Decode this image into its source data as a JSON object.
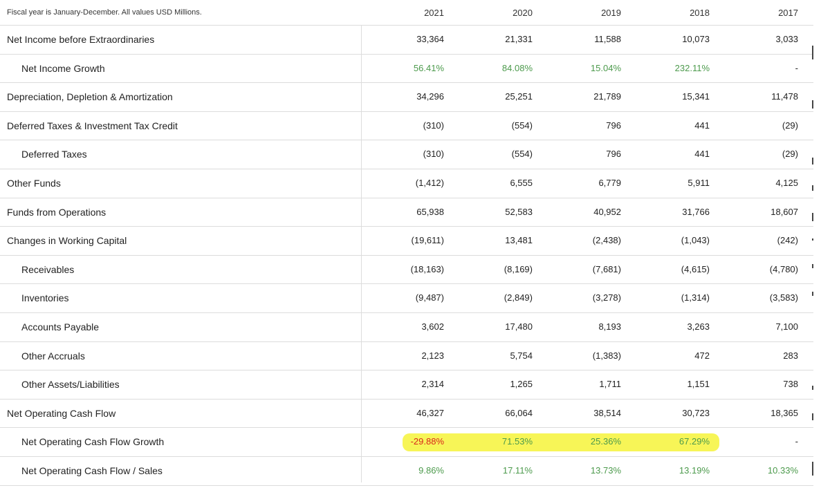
{
  "table": {
    "note": "Fiscal year is January-December. All values USD Millions.",
    "years": [
      "2021",
      "2020",
      "2019",
      "2018",
      "2017"
    ],
    "rows": [
      {
        "label": "Net Income before Extraordinaries",
        "values": [
          "33,364",
          "21,331",
          "11,588",
          "10,073",
          "3,033"
        ]
      },
      {
        "label": "Net Income Growth",
        "values": [
          "56.41%",
          "84.08%",
          "15.04%",
          "232.11%",
          "-"
        ]
      },
      {
        "label": "Depreciation, Depletion & Amortization",
        "values": [
          "34,296",
          "25,251",
          "21,789",
          "15,341",
          "11,478"
        ]
      },
      {
        "label": "Deferred Taxes & Investment Tax Credit",
        "values": [
          "(310)",
          "(554)",
          "796",
          "441",
          "(29)"
        ]
      },
      {
        "label": "Deferred Taxes",
        "values": [
          "(310)",
          "(554)",
          "796",
          "441",
          "(29)"
        ]
      },
      {
        "label": "Other Funds",
        "values": [
          "(1,412)",
          "6,555",
          "6,779",
          "5,911",
          "4,125"
        ]
      },
      {
        "label": "Funds from Operations",
        "values": [
          "65,938",
          "52,583",
          "40,952",
          "31,766",
          "18,607"
        ]
      },
      {
        "label": "Changes in Working Capital",
        "values": [
          "(19,611)",
          "13,481",
          "(2,438)",
          "(1,043)",
          "(242)"
        ]
      },
      {
        "label": "Receivables",
        "values": [
          "(18,163)",
          "(8,169)",
          "(7,681)",
          "(4,615)",
          "(4,780)"
        ]
      },
      {
        "label": "Inventories",
        "values": [
          "(9,487)",
          "(2,849)",
          "(3,278)",
          "(1,314)",
          "(3,583)"
        ]
      },
      {
        "label": "Accounts Payable",
        "values": [
          "3,602",
          "17,480",
          "8,193",
          "3,263",
          "7,100"
        ]
      },
      {
        "label": "Other Accruals",
        "values": [
          "2,123",
          "5,754",
          "(1,383)",
          "472",
          "283"
        ]
      },
      {
        "label": "Other Assets/Liabilities",
        "values": [
          "2,314",
          "1,265",
          "1,711",
          "1,151",
          "738"
        ]
      },
      {
        "label": "Net Operating Cash Flow",
        "values": [
          "46,327",
          "66,064",
          "38,514",
          "30,723",
          "18,365"
        ]
      },
      {
        "label": "Net Operating Cash Flow Growth",
        "values": [
          "-29.88%",
          "71.53%",
          "25.36%",
          "67.29%",
          "-"
        ]
      },
      {
        "label": "Net Operating Cash Flow / Sales",
        "values": [
          "9.86%",
          "17.11%",
          "13.73%",
          "13.19%",
          "10.33%"
        ]
      }
    ]
  },
  "colors": {
    "positive": "#4c9a4c",
    "negative": "#d9261c",
    "highlight": "#f6f33a"
  }
}
